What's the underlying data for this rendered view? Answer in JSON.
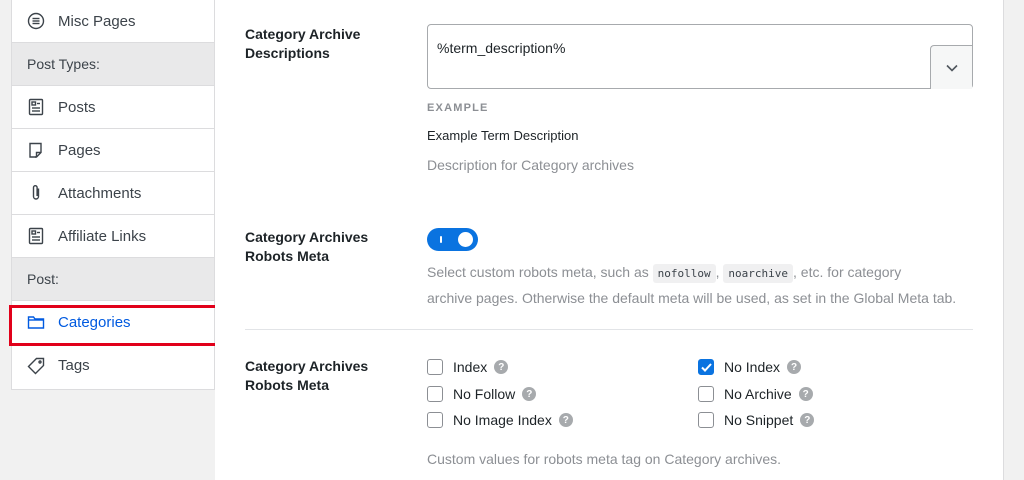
{
  "sidebar": {
    "items": [
      {
        "label": "Misc Pages",
        "icon": "list-circle-icon"
      },
      {
        "group": "Post Types:"
      },
      {
        "label": "Posts",
        "icon": "posts-icon"
      },
      {
        "label": "Pages",
        "icon": "pages-icon"
      },
      {
        "label": "Attachments",
        "icon": "paperclip-icon"
      },
      {
        "label": "Affiliate Links",
        "icon": "affiliate-links-icon"
      },
      {
        "group": "Post:"
      },
      {
        "label": "Categories",
        "icon": "folder-icon",
        "active": true
      },
      {
        "label": "Tags",
        "icon": "tag-icon"
      }
    ]
  },
  "main": {
    "descriptions": {
      "label": "Category Archive Descriptions",
      "value": "%term_description%",
      "example_heading": "EXAMPLE",
      "example_value": "Example Term Description",
      "help": "Description for Category archives"
    },
    "robots_toggle": {
      "label": "Category Archives Robots Meta",
      "enabled": true,
      "help_prefix": "Select custom robots meta, such as",
      "code1": "nofollow",
      "code2": "noarchive",
      "help_mid": ", etc. for category",
      "help_line2": "archive pages. Otherwise the default meta will be used, as set in the Global Meta tab."
    },
    "robots_meta": {
      "label": "Category Archives Robots Meta",
      "options": [
        {
          "label": "Index",
          "checked": false
        },
        {
          "label": "No Follow",
          "checked": false
        },
        {
          "label": "No Image Index",
          "checked": false
        },
        {
          "label": "No Index",
          "checked": true
        },
        {
          "label": "No Archive",
          "checked": false
        },
        {
          "label": "No Snippet",
          "checked": false
        }
      ],
      "help_glyph": "?",
      "help": "Custom values for robots meta tag on Category archives."
    }
  },
  "colors": {
    "accent": "#0a73e0",
    "highlight": "#e1001a",
    "active_link": "#005ae0"
  }
}
